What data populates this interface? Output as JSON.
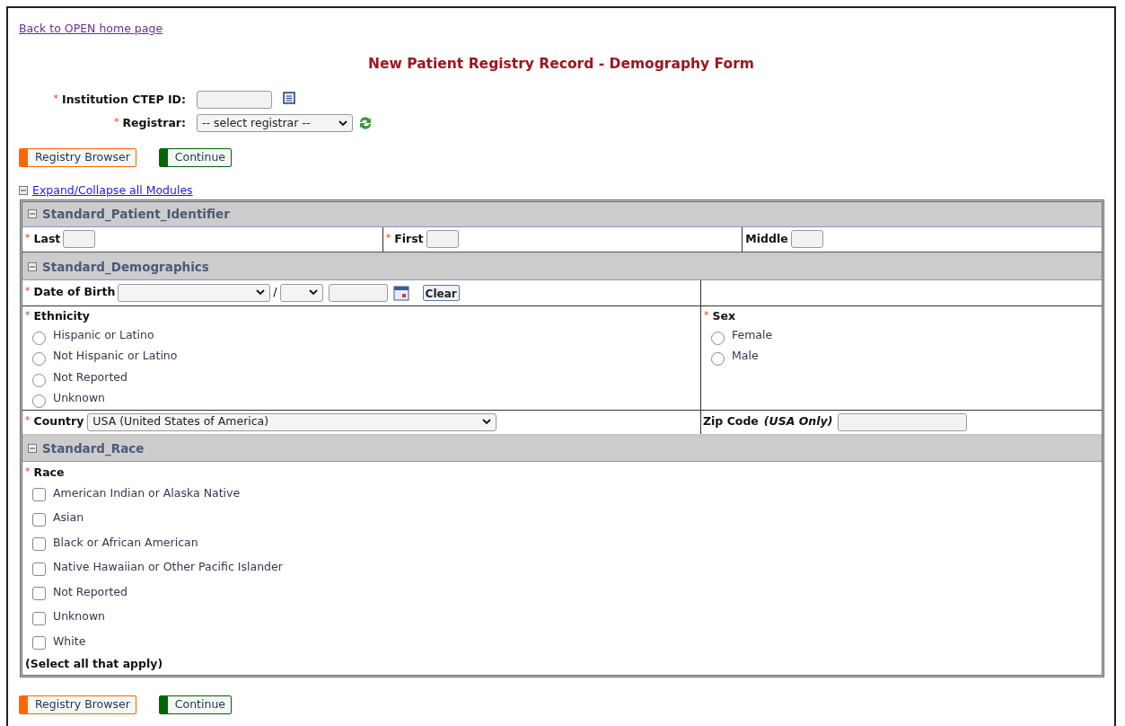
{
  "back_link": "Back to OPEN home page",
  "title": "New Patient Registry Record - Demography Form",
  "required_mark": "*",
  "institution": {
    "label": "Institution CTEP ID:",
    "required": true
  },
  "registrar": {
    "label": "Registrar:",
    "required": true,
    "value": "-- select registrar --"
  },
  "top_buttons": [
    {
      "label": "Registry Browser",
      "color": "#ff6600"
    },
    {
      "label": "Continue",
      "color": "#006600"
    }
  ],
  "expand_link": "Expand/Collapse all Modules",
  "modules": {
    "identifier": {
      "title": "Standard_Patient_Identifier",
      "expanded": true,
      "fields": [
        {
          "label": "Last",
          "required": true
        },
        {
          "label": "First",
          "required": true
        },
        {
          "label": "Middle",
          "required": false
        }
      ]
    },
    "demographics": {
      "title": "Standard_Demographics",
      "expanded": true,
      "dob": {
        "label": "Date of Birth",
        "required": true,
        "separator": "/",
        "clear": "Clear"
      },
      "ethnicity": {
        "label": "Ethnicity",
        "required": true,
        "options": [
          {
            "label": "Hispanic or Latino",
            "selected": false
          },
          {
            "label": "Not Hispanic or Latino",
            "selected": false
          },
          {
            "label": "Not Reported",
            "selected": false
          },
          {
            "label": "Unknown",
            "selected": false
          }
        ]
      },
      "sex": {
        "label": "Sex",
        "required": true,
        "options": [
          {
            "label": "Female",
            "selected": false
          },
          {
            "label": "Male",
            "selected": false
          }
        ]
      },
      "country": {
        "label": "Country",
        "required": true,
        "value": "USA (United States of America)"
      },
      "zip": {
        "label": "Zip Code",
        "note": "(USA Only)",
        "required": false
      }
    },
    "race": {
      "title": "Standard_Race",
      "expanded": true,
      "label": "Race",
      "required": true,
      "options": [
        {
          "label": "American Indian or Alaska Native",
          "checked": false
        },
        {
          "label": "Asian",
          "checked": false
        },
        {
          "label": "Black or African American",
          "checked": false
        },
        {
          "label": "Native Hawaiian or Other Pacific Islander",
          "checked": false
        },
        {
          "label": "Not Reported",
          "checked": false
        },
        {
          "label": "Unknown",
          "checked": false
        },
        {
          "label": "White",
          "checked": false
        }
      ],
      "hint": "(Select all that apply)"
    }
  },
  "bottom_buttons": [
    {
      "label": "Registry Browser",
      "color": "#ff6600"
    },
    {
      "label": "Continue",
      "color": "#006600"
    }
  ]
}
